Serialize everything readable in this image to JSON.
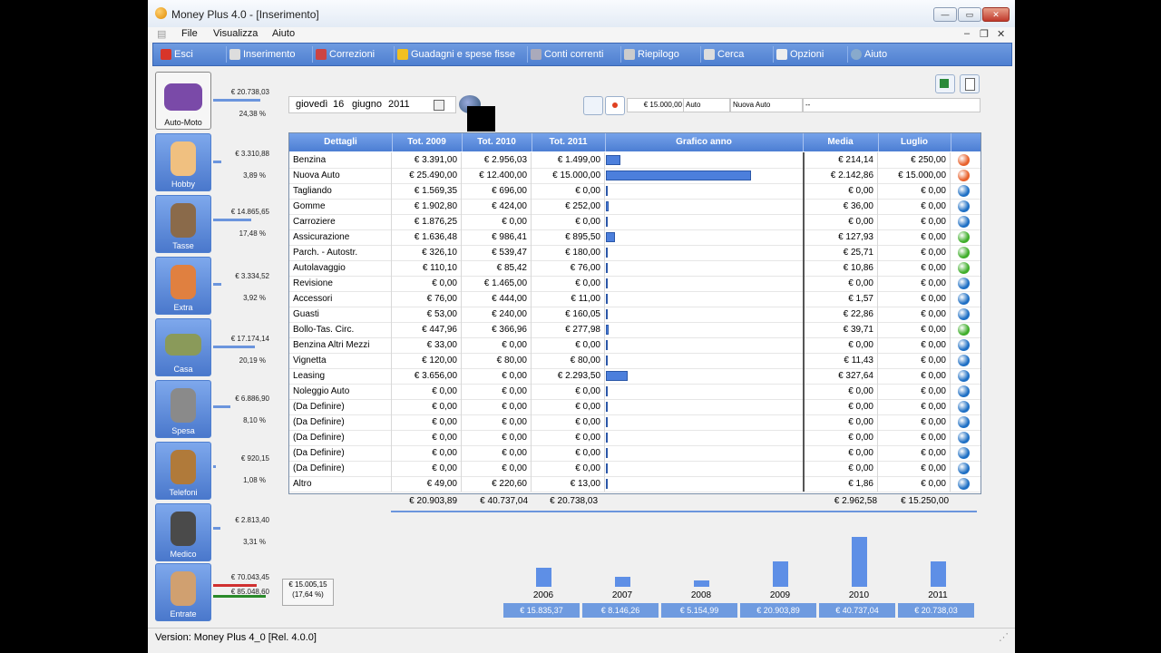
{
  "window": {
    "title": "Money Plus 4.0 - [Inserimento]"
  },
  "menu": [
    "File",
    "Visualizza",
    "Aiuto"
  ],
  "toolbar": [
    "Esci",
    "Inserimento",
    "Correzioni",
    "Guadagni e spese fisse",
    "Conti correnti",
    "Riepilogo",
    "Cerca",
    "Opzioni",
    "Aiuto"
  ],
  "sidebar": [
    {
      "label": "Auto-Moto",
      "amount": "€ 20.738,03",
      "pct": "24,38 %",
      "bar_fraction": 0.9
    },
    {
      "label": "Hobby",
      "amount": "€ 3.310,88",
      "pct": "3,89 %",
      "bar_fraction": 0.15
    },
    {
      "label": "Tasse",
      "amount": "€ 14.865,65",
      "pct": "17,48 %",
      "bar_fraction": 0.72
    },
    {
      "label": "Extra",
      "amount": "€ 3.334,52",
      "pct": "3,92 %",
      "bar_fraction": 0.16
    },
    {
      "label": "Casa",
      "amount": "€ 17.174,14",
      "pct": "20,19 %",
      "bar_fraction": 0.8
    },
    {
      "label": "Spesa",
      "amount": "€ 6.886,90",
      "pct": "8,10 %",
      "bar_fraction": 0.33
    },
    {
      "label": "Telefoni",
      "amount": "€ 920,15",
      "pct": "1,08 %",
      "bar_fraction": 0.05
    },
    {
      "label": "Medico",
      "amount": "€ 2.813,40",
      "pct": "3,31 %",
      "bar_fraction": 0.13
    },
    {
      "label": "Entrate",
      "amount": "€ 70.043,45",
      "pct": "",
      "bar_fraction": 0.82
    }
  ],
  "entrate_extra": {
    "amount2": "€ 85.048,60",
    "summary1": "€ 15.005,15",
    "summary2": "(17,64 %)"
  },
  "date": {
    "weekday": "giovedì",
    "day": "16",
    "month": "giugno",
    "year": "2011"
  },
  "edit": {
    "amount": "€ 15.000,00",
    "category": "Auto",
    "item": "Nuova Auto",
    "note": "--"
  },
  "table": {
    "headers": [
      "Dettagli",
      "Tot. 2009",
      "Tot. 2010",
      "Tot. 2011",
      "Grafico anno",
      "Media",
      "Luglio"
    ],
    "rows": [
      {
        "name": "Benzina",
        "t2009": "€ 3.391,00",
        "t2010": "€ 2.956,03",
        "t2011": "€ 1.499,00",
        "media": "€ 214,14",
        "luglio": "€ 250,00",
        "bar": 1499,
        "dot": "#e8612c"
      },
      {
        "name": "Nuova Auto",
        "t2009": "€ 25.490,00",
        "t2010": "€ 12.400,00",
        "t2011": "€ 15.000,00",
        "media": "€ 2.142,86",
        "luglio": "€ 15.000,00",
        "bar": 15000,
        "dot": "#e8612c"
      },
      {
        "name": "Tagliando",
        "t2009": "€ 1.569,35",
        "t2010": "€ 696,00",
        "t2011": "€ 0,00",
        "media": "€ 0,00",
        "luglio": "€ 0,00",
        "bar": 0,
        "dot": "#1e6fc4"
      },
      {
        "name": "Gomme",
        "t2009": "€ 1.902,80",
        "t2010": "€ 424,00",
        "t2011": "€ 252,00",
        "media": "€ 36,00",
        "luglio": "€ 0,00",
        "bar": 252,
        "dot": "#1e6fc4"
      },
      {
        "name": "Carroziere",
        "t2009": "€ 1.876,25",
        "t2010": "€ 0,00",
        "t2011": "€ 0,00",
        "media": "€ 0,00",
        "luglio": "€ 0,00",
        "bar": 0,
        "dot": "#1e6fc4"
      },
      {
        "name": "Assicurazione",
        "t2009": "€ 1.636,48",
        "t2010": "€ 986,41",
        "t2011": "€ 895,50",
        "media": "€ 127,93",
        "luglio": "€ 0,00",
        "bar": 895.5,
        "dot": "#3fae2a"
      },
      {
        "name": "Parch. - Autostr.",
        "t2009": "€ 326,10",
        "t2010": "€ 539,47",
        "t2011": "€ 180,00",
        "media": "€ 25,71",
        "luglio": "€ 0,00",
        "bar": 180,
        "dot": "#3fae2a"
      },
      {
        "name": "Autolavaggio",
        "t2009": "€ 110,10",
        "t2010": "€ 85,42",
        "t2011": "€ 76,00",
        "media": "€ 10,86",
        "luglio": "€ 0,00",
        "bar": 76,
        "dot": "#3fae2a"
      },
      {
        "name": "Revisione",
        "t2009": "€ 0,00",
        "t2010": "€ 1.465,00",
        "t2011": "€ 0,00",
        "media": "€ 0,00",
        "luglio": "€ 0,00",
        "bar": 0,
        "dot": "#1e6fc4"
      },
      {
        "name": "Accessori",
        "t2009": "€ 76,00",
        "t2010": "€ 444,00",
        "t2011": "€ 11,00",
        "media": "€ 1,57",
        "luglio": "€ 0,00",
        "bar": 11,
        "dot": "#1e6fc4"
      },
      {
        "name": "Guasti",
        "t2009": "€ 53,00",
        "t2010": "€ 240,00",
        "t2011": "€ 160,05",
        "media": "€ 22,86",
        "luglio": "€ 0,00",
        "bar": 160.05,
        "dot": "#1e6fc4"
      },
      {
        "name": "Bollo-Tas. Circ.",
        "t2009": "€ 447,96",
        "t2010": "€ 366,96",
        "t2011": "€ 277,98",
        "media": "€ 39,71",
        "luglio": "€ 0,00",
        "bar": 277.98,
        "dot": "#3fae2a"
      },
      {
        "name": "Benzina Altri Mezzi",
        "t2009": "€ 33,00",
        "t2010": "€ 0,00",
        "t2011": "€ 0,00",
        "media": "€ 0,00",
        "luglio": "€ 0,00",
        "bar": 0,
        "dot": "#1e6fc4"
      },
      {
        "name": "Vignetta",
        "t2009": "€ 120,00",
        "t2010": "€ 80,00",
        "t2011": "€ 80,00",
        "media": "€ 11,43",
        "luglio": "€ 0,00",
        "bar": 80,
        "dot": "#1e6fc4"
      },
      {
        "name": "Leasing",
        "t2009": "€ 3.656,00",
        "t2010": "€ 0,00",
        "t2011": "€ 2.293,50",
        "media": "€ 327,64",
        "luglio": "€ 0,00",
        "bar": 2293.5,
        "dot": "#1e6fc4"
      },
      {
        "name": "Noleggio Auto",
        "t2009": "€ 0,00",
        "t2010": "€ 0,00",
        "t2011": "€ 0,00",
        "media": "€ 0,00",
        "luglio": "€ 0,00",
        "bar": 0,
        "dot": "#1e6fc4"
      },
      {
        "name": "(Da Definire)",
        "t2009": "€ 0,00",
        "t2010": "€ 0,00",
        "t2011": "€ 0,00",
        "media": "€ 0,00",
        "luglio": "€ 0,00",
        "bar": 0,
        "dot": "#1e6fc4"
      },
      {
        "name": "(Da Definire)",
        "t2009": "€ 0,00",
        "t2010": "€ 0,00",
        "t2011": "€ 0,00",
        "media": "€ 0,00",
        "luglio": "€ 0,00",
        "bar": 0,
        "dot": "#1e6fc4"
      },
      {
        "name": "(Da Definire)",
        "t2009": "€ 0,00",
        "t2010": "€ 0,00",
        "t2011": "€ 0,00",
        "media": "€ 0,00",
        "luglio": "€ 0,00",
        "bar": 0,
        "dot": "#1e6fc4"
      },
      {
        "name": "(Da Definire)",
        "t2009": "€ 0,00",
        "t2010": "€ 0,00",
        "t2011": "€ 0,00",
        "media": "€ 0,00",
        "luglio": "€ 0,00",
        "bar": 0,
        "dot": "#1e6fc4"
      },
      {
        "name": "(Da Definire)",
        "t2009": "€ 0,00",
        "t2010": "€ 0,00",
        "t2011": "€ 0,00",
        "media": "€ 0,00",
        "luglio": "€ 0,00",
        "bar": 0,
        "dot": "#1e6fc4"
      },
      {
        "name": "Altro",
        "t2009": "€ 49,00",
        "t2010": "€ 220,60",
        "t2011": "€ 13,00",
        "media": "€ 1,86",
        "luglio": "€ 0,00",
        "bar": 13,
        "dot": "#1e6fc4"
      }
    ],
    "totals": {
      "t2009": "€ 20.903,89",
      "t2010": "€ 40.737,04",
      "t2011": "€ 20.738,03",
      "media": "€ 2.962,58",
      "luglio": "€ 15.250,00"
    }
  },
  "history": [
    {
      "year": "2006",
      "amount": "€ 15.835,37",
      "value": 15835.37
    },
    {
      "year": "2007",
      "amount": "€ 8.146,26",
      "value": 8146.26
    },
    {
      "year": "2008",
      "amount": "€ 5.154,99",
      "value": 5154.99
    },
    {
      "year": "2009",
      "amount": "€ 20.903,89",
      "value": 20903.89
    },
    {
      "year": "2010",
      "amount": "€ 40.737,04",
      "value": 40737.04
    },
    {
      "year": "2011",
      "amount": "€ 20.738,03",
      "value": 20738.03
    }
  ],
  "status": "Version: Money Plus 4_0   [Rel. 4.0.0]"
}
